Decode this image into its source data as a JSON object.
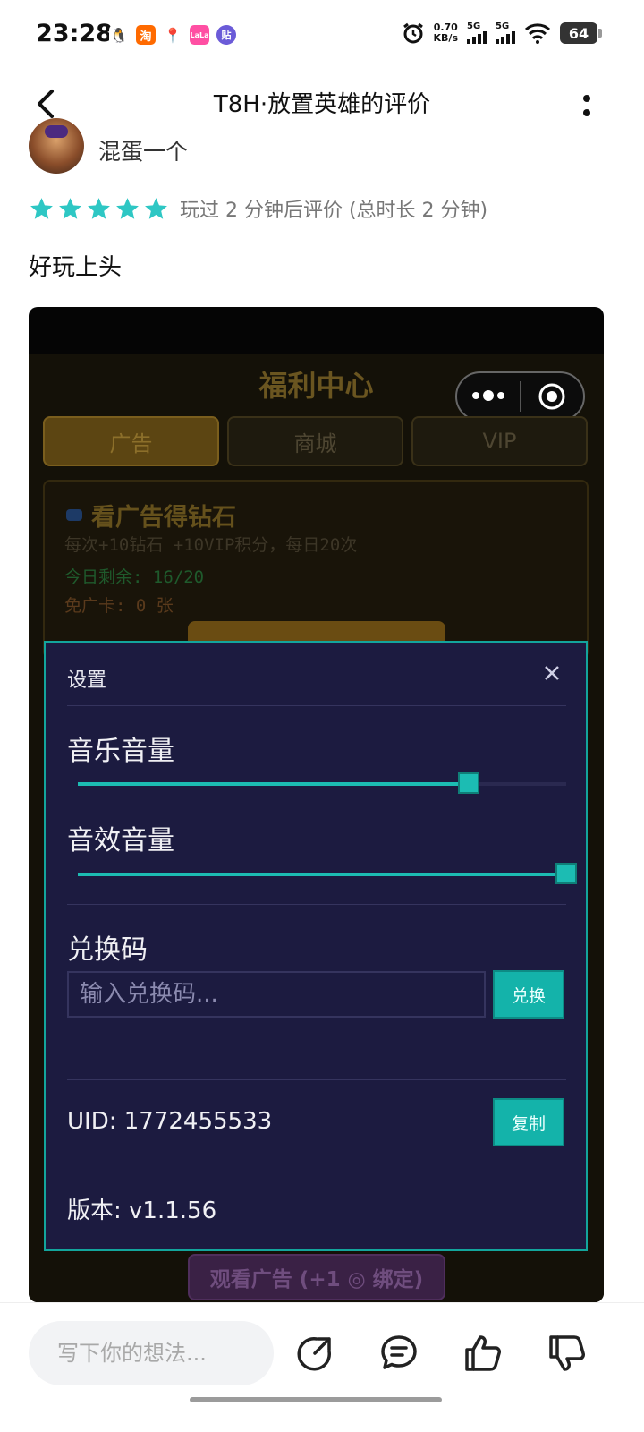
{
  "status_bar": {
    "time": "23:28",
    "apps": [
      {
        "icon": "qq-icon",
        "glyph": "🐧",
        "color": "#ffffff"
      },
      {
        "icon": "taobao-icon",
        "glyph": "淘",
        "color": "#ff6a00"
      },
      {
        "icon": "map-pin-app-icon",
        "glyph": "📍",
        "color": "#ffffff"
      },
      {
        "icon": "lala-app-icon",
        "glyph": "LaLa",
        "color": "#ff4fa3"
      },
      {
        "icon": "tieba-icon",
        "glyph": "贴",
        "color": "#6b5bd8"
      }
    ],
    "net_speed_value": "0.70",
    "net_speed_unit": "KB/s",
    "signal1_label": "5G",
    "signal2_label": "5G",
    "battery": "64"
  },
  "header": {
    "title": "T8H·放置英雄的评价"
  },
  "review": {
    "username": "混蛋一个",
    "stars": 5,
    "rating_note": "玩过 2 分钟后评价 (总时长 2 分钟)",
    "body": "好玩上头"
  },
  "game": {
    "center_title": "福利中心",
    "tabs": [
      "广告",
      "商城",
      "VIP"
    ],
    "active_tab_index": 0,
    "panel_title": "看广告得钻石",
    "panel_line1": "每次+10钻石 +10VIP积分，每日20次",
    "panel_line2": "今日剩余: 16/20",
    "panel_line3": "免广卡: 0 张",
    "bottom_button": "观看广告 (+1 ◎ 绑定)"
  },
  "settings": {
    "title": "设置",
    "music_label": "音乐音量",
    "music_volume": 0.8,
    "sfx_label": "音效音量",
    "sfx_volume": 1.0,
    "code_label": "兑换码",
    "code_placeholder": "输入兑换码...",
    "redeem_button": "兑换",
    "uid_text": "UID: 1772455533",
    "copy_button": "复制",
    "version_text": "版本: v1.1.56"
  },
  "bottom_bar": {
    "comment_placeholder": "写下你的想法...",
    "actions": [
      "share-icon",
      "comment-icon",
      "thumbs-up-icon",
      "thumbs-down-icon"
    ]
  }
}
